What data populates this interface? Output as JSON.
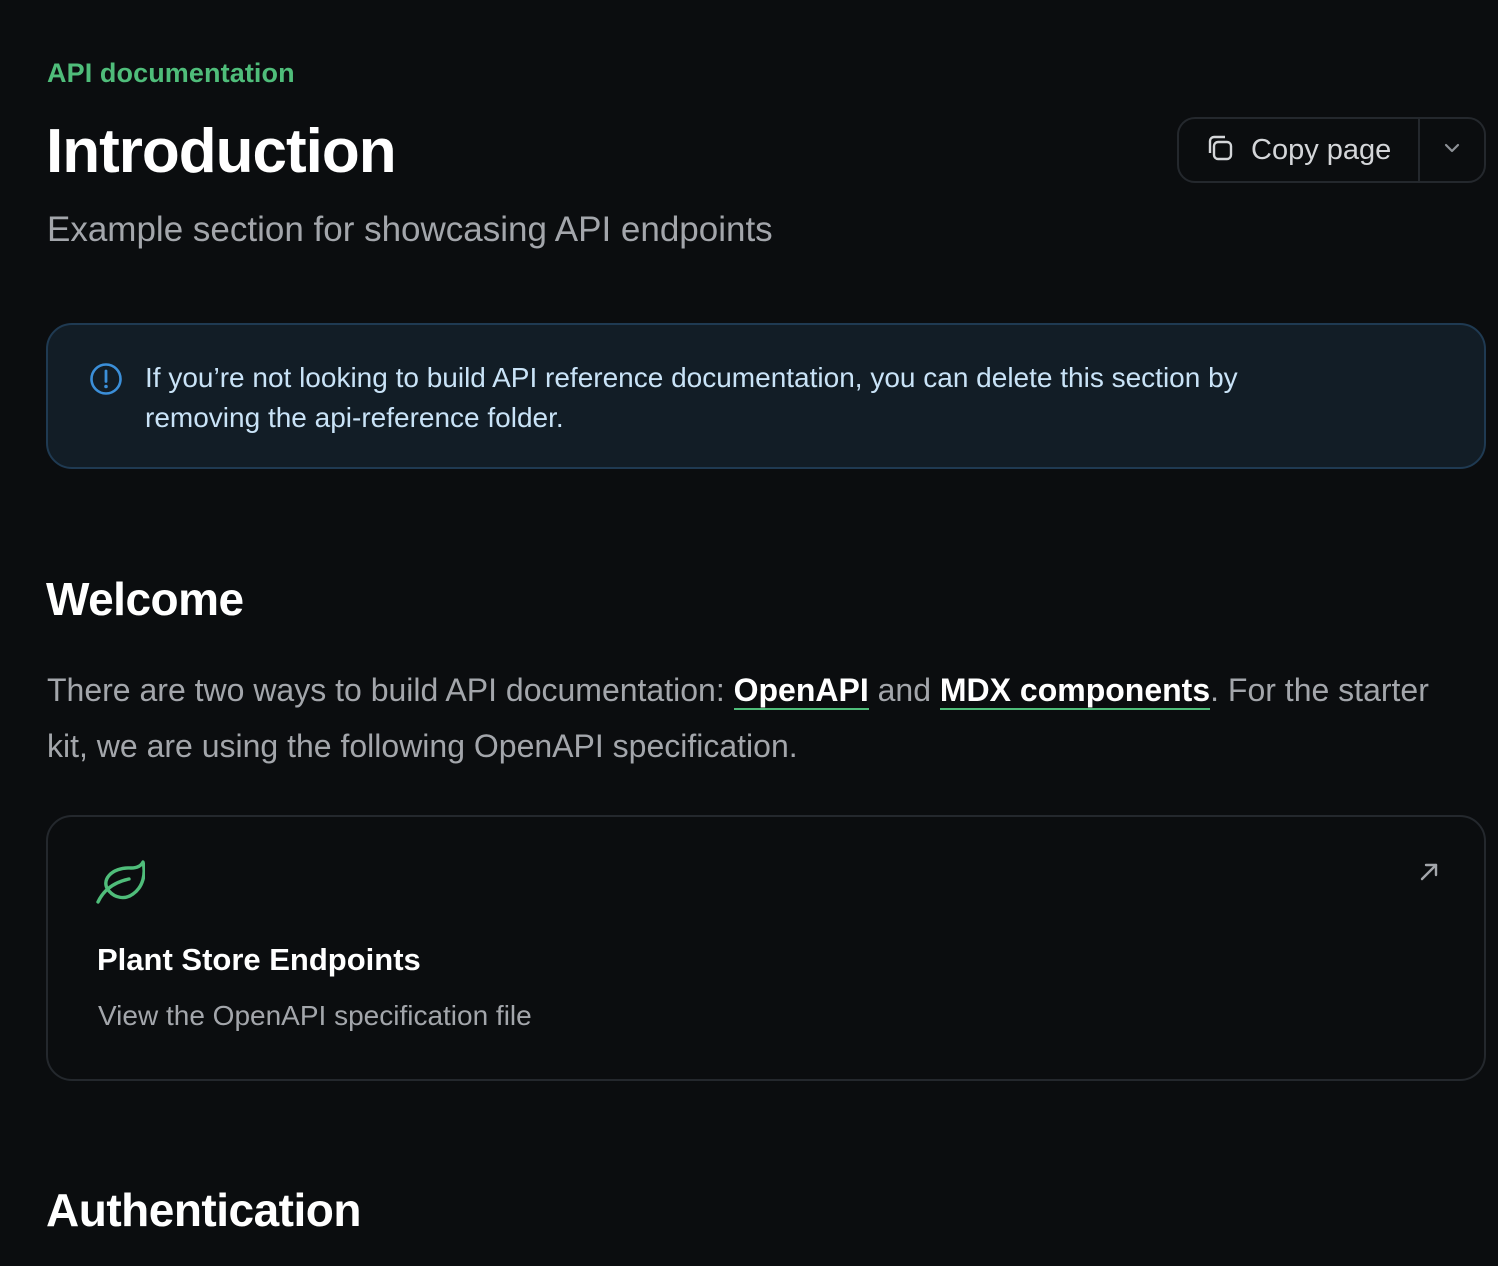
{
  "header": {
    "eyebrow": "API documentation",
    "title": "Introduction",
    "subtitle": "Example section for showcasing API endpoints",
    "copy_label": "Copy page"
  },
  "callout": {
    "line1": "If you’re not looking to build API reference documentation, you can delete this section by",
    "line2": "removing the api-reference folder."
  },
  "welcome": {
    "heading": "Welcome",
    "text_before": "There are two ways to build API documentation: ",
    "link1": "OpenAPI",
    "text_middle": " and ",
    "link2": "MDX components",
    "text_after": ". For the starter kit, we are using the following OpenAPI specification."
  },
  "card": {
    "title": "Plant Store Endpoints",
    "description": "View the OpenAPI specification file",
    "icon": "leaf-icon"
  },
  "auth": {
    "heading": "Authentication"
  },
  "colors": {
    "background": "#0b0d0f",
    "accent": "#4fbd7a",
    "info": "#3b8fd9"
  }
}
